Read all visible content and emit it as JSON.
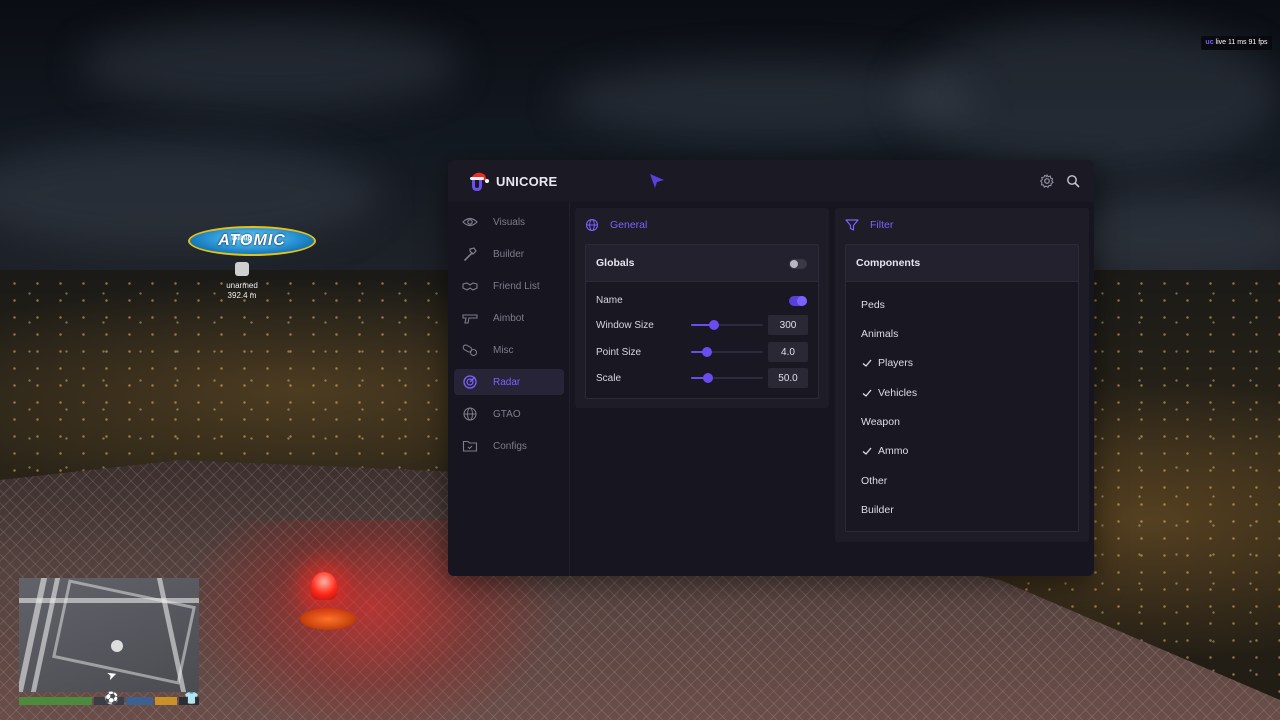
{
  "game": {
    "blimp_text": "ATOMIC",
    "blimp_tag": "Blimp",
    "esp_weapon": "unarmed",
    "esp_distance": "392.4 m",
    "overlay": {
      "brand": "uc",
      "text": "live 11 ms 91 fps"
    }
  },
  "menu": {
    "brand": "UNICORE",
    "accent": "#7b62ff",
    "nav": [
      {
        "label": "Visuals",
        "icon": "eye-icon",
        "active": false
      },
      {
        "label": "Builder",
        "icon": "hammer-icon",
        "active": false
      },
      {
        "label": "Friend List",
        "icon": "handshake-icon",
        "active": false
      },
      {
        "label": "Aimbot",
        "icon": "gun-icon",
        "active": false
      },
      {
        "label": "Misc",
        "icon": "pills-icon",
        "active": false
      },
      {
        "label": "Radar",
        "icon": "radar-icon",
        "active": true
      },
      {
        "label": "GTAO",
        "icon": "globe-icon",
        "active": false
      },
      {
        "label": "Configs",
        "icon": "folder-icon",
        "active": false
      }
    ],
    "general": {
      "title": "General",
      "globals_label": "Globals",
      "globals_enabled": false,
      "name_label": "Name",
      "name_enabled": true,
      "sliders": [
        {
          "label": "Window Size",
          "value": "300",
          "fraction": 0.32
        },
        {
          "label": "Point Size",
          "value": "4.0",
          "fraction": 0.22
        },
        {
          "label": "Scale",
          "value": "50.0",
          "fraction": 0.23
        }
      ]
    },
    "filter": {
      "title": "Filter",
      "components_label": "Components",
      "items": [
        {
          "label": "Peds",
          "checked": false
        },
        {
          "label": "Animals",
          "checked": false
        },
        {
          "label": "Players",
          "checked": true
        },
        {
          "label": "Vehicles",
          "checked": true
        },
        {
          "label": "Weapon",
          "checked": false
        },
        {
          "label": "Ammo",
          "checked": true
        },
        {
          "label": "Other",
          "checked": false
        },
        {
          "label": "Builder",
          "checked": false
        }
      ]
    }
  }
}
